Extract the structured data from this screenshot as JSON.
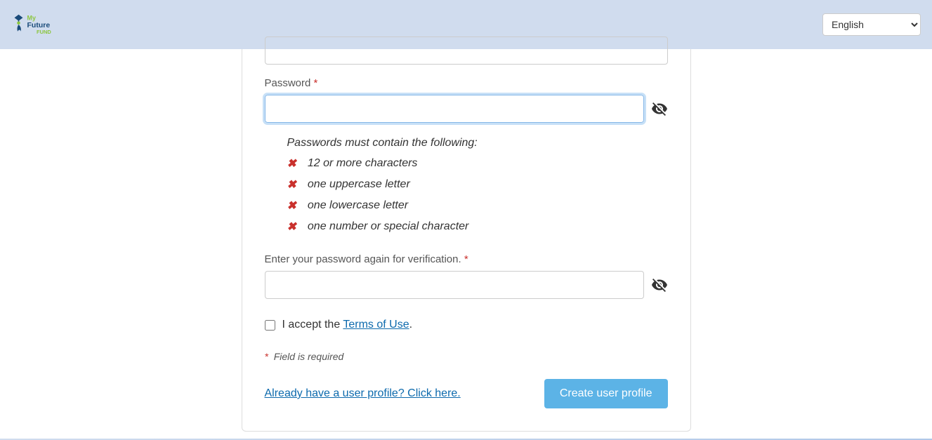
{
  "header": {
    "logo_text_1": "My",
    "logo_text_2": "Future",
    "logo_text_3": "FUND",
    "language": "English"
  },
  "form": {
    "password_label": "Password",
    "password_value": "",
    "confirm_label": "Enter your password again for verification.",
    "confirm_value": "",
    "requirements_title": "Passwords must contain the following:",
    "requirements": [
      "12 or more characters",
      "one uppercase letter",
      "one lowercase letter",
      "one number or special character"
    ],
    "terms_prefix": "I accept the ",
    "terms_link": "Terms of Use",
    "terms_suffix": ".",
    "required_note": "Field is required",
    "existing_link": "Already have a user profile? Click here.",
    "create_button": "Create user profile"
  }
}
